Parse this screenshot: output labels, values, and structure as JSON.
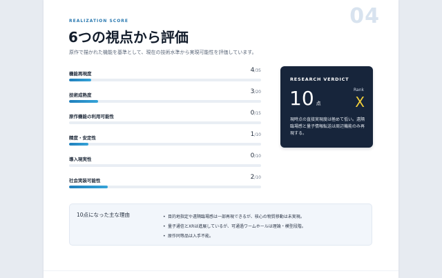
{
  "section_number": "04",
  "eyebrow": "REALIZATION SCORE",
  "title": "6つの視点から評価",
  "subtitle": "原作で描かれた機能を基準として、現在の技術水準から実現可能性を評価しています。",
  "metrics": [
    {
      "label": "機能再現度",
      "score": "4",
      "max": "/35",
      "fraction": 0.114
    },
    {
      "label": "技術成熟度",
      "score": "3",
      "max": "/20",
      "fraction": 0.15
    },
    {
      "label": "原作機能の利用可能性",
      "score": "0",
      "max": "/15",
      "fraction": 0.0
    },
    {
      "label": "精度・安定性",
      "score": "1",
      "max": "/10",
      "fraction": 0.1
    },
    {
      "label": "導入現実性",
      "score": "0",
      "max": "/10",
      "fraction": 0.0
    },
    {
      "label": "社会実装可能性",
      "score": "2",
      "max": "/10",
      "fraction": 0.2
    }
  ],
  "verdict": {
    "heading": "RESEARCH VERDICT",
    "score": "10",
    "unit": "点",
    "rank_label": "Rank",
    "rank": "X",
    "note": "現時点の直接実現度は極めて低い。遠隔臨場感と量子情報転送は周辺機能のみ再現する。"
  },
  "reasons": {
    "heading": "10点になった主な理由",
    "items": [
      "目的地指定や遠隔臨場感は一部再現できるが、核心の物質移動は未実現。",
      "量子通信とXRは進展しているが、可通過ワームホールは理論・模型段階。",
      "原作同等品は入手不能。"
    ]
  },
  "colors": {
    "accent": "#2a79b0",
    "bar_fill": "#1f7fbc",
    "verdict_bg": "#17253b",
    "rank_color": "#f2cf3a"
  }
}
